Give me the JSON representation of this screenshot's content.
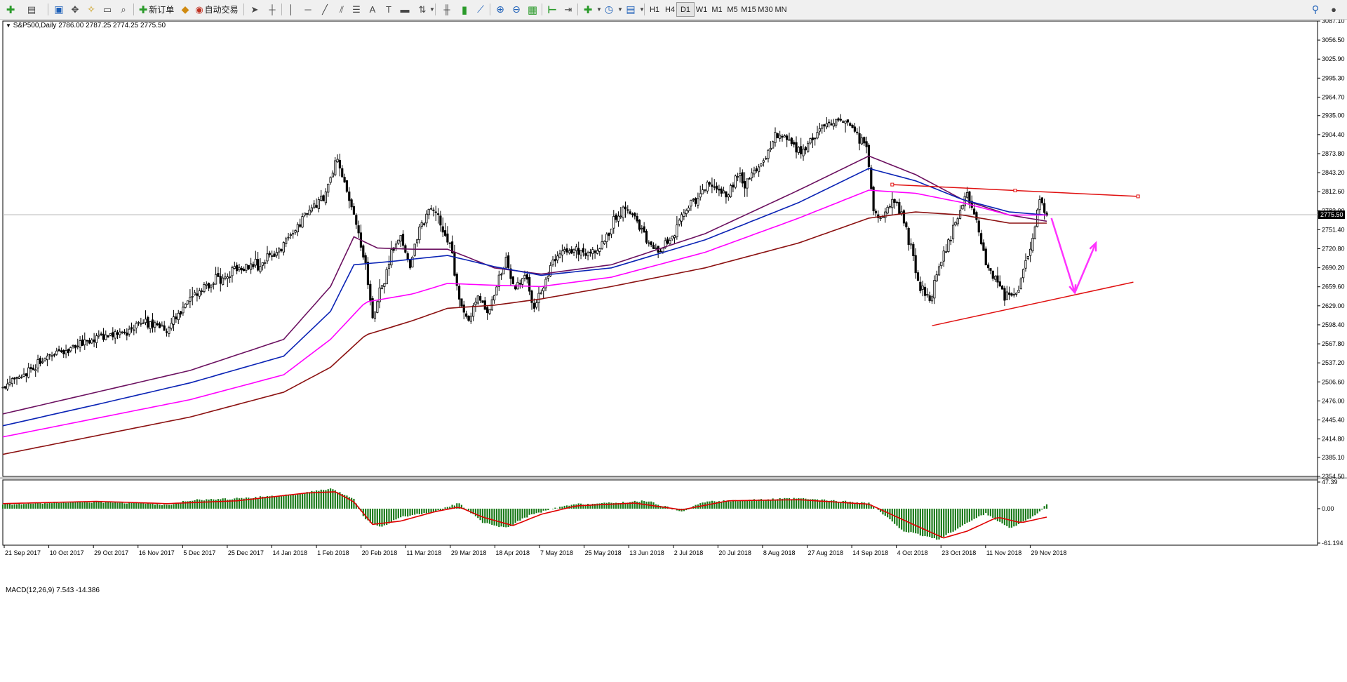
{
  "toolbar": {
    "new_order_label": "新订单",
    "auto_trading_label": "自动交易",
    "timeframes": [
      "H1",
      "H4",
      "D1",
      "W1",
      "M1",
      "M5",
      "M15",
      "M30",
      "MN"
    ],
    "active_timeframe": "D1"
  },
  "chart_header": {
    "symbol_label": "S&P500,Daily",
    "ohlc": "2786.00 2787.25 2774.25 2775.50"
  },
  "macd_header": {
    "label": "MACD(12,26,9)",
    "values": "7.543 -14.386"
  },
  "colors": {
    "candle": "#000000",
    "ma_fast": "#6b1060",
    "ma_mid": "#0a23b5",
    "ma_slow": "#ff00ff",
    "ma_long": "#8b1010",
    "trendline": "#e01010",
    "arrow": "#ff33ff",
    "macd_hist": "#1a7a1a",
    "macd_signal": "#e00000",
    "price_line": "#b8b8b8"
  },
  "chart_data": {
    "type": "candlestick",
    "symbol": "S&P500",
    "timeframe": "Daily",
    "current_price": 2775.5,
    "ylim": [
      2354.5,
      3087.1
    ],
    "y_ticks": [
      "3087.10",
      "3056.50",
      "3025.90",
      "2995.30",
      "2964.70",
      "2935.00",
      "2904.40",
      "2873.80",
      "2843.20",
      "2812.60",
      "2782.00",
      "2751.40",
      "2720.80",
      "2690.20",
      "2659.60",
      "2629.00",
      "2598.40",
      "2567.80",
      "2537.20",
      "2506.60",
      "2476.00",
      "2445.40",
      "2414.80",
      "2385.10",
      "2354.50"
    ],
    "x_ticks": [
      "21 Sep 2017",
      "10 Oct 2017",
      "29 Oct 2017",
      "16 Nov 2017",
      "5 Dec 2017",
      "25 Dec 2017",
      "14 Jan 2018",
      "1 Feb 2018",
      "20 Feb 2018",
      "11 Mar 2018",
      "29 Mar 2018",
      "18 Apr 2018",
      "7 May 2018",
      "25 May 2018",
      "13 Jun 2018",
      "2 Jul 2018",
      "20 Jul 2018",
      "8 Aug 2018",
      "27 Aug 2018",
      "14 Sep 2018",
      "4 Oct 2018",
      "23 Oct 2018",
      "11 Nov 2018",
      "29 Nov 2018"
    ],
    "price_path": [
      [
        0,
        2500
      ],
      [
        10,
        2520
      ],
      [
        20,
        2550
      ],
      [
        30,
        2562
      ],
      [
        40,
        2578
      ],
      [
        50,
        2585
      ],
      [
        60,
        2600
      ],
      [
        70,
        2592
      ],
      [
        80,
        2642
      ],
      [
        90,
        2668
      ],
      [
        100,
        2688
      ],
      [
        110,
        2695
      ],
      [
        120,
        2725
      ],
      [
        130,
        2780
      ],
      [
        137,
        2800
      ],
      [
        143,
        2870
      ],
      [
        146,
        2830
      ],
      [
        150,
        2780
      ],
      [
        155,
        2700
      ],
      [
        158,
        2612
      ],
      [
        162,
        2660
      ],
      [
        166,
        2710
      ],
      [
        170,
        2745
      ],
      [
        174,
        2690
      ],
      [
        178,
        2752
      ],
      [
        183,
        2785
      ],
      [
        187,
        2760
      ],
      [
        191,
        2730
      ],
      [
        195,
        2640
      ],
      [
        199,
        2605
      ],
      [
        203,
        2650
      ],
      [
        207,
        2620
      ],
      [
        211,
        2660
      ],
      [
        215,
        2700
      ],
      [
        219,
        2655
      ],
      [
        223,
        2680
      ],
      [
        227,
        2630
      ],
      [
        231,
        2660
      ],
      [
        235,
        2700
      ],
      [
        239,
        2720
      ],
      [
        245,
        2715
      ],
      [
        251,
        2712
      ],
      [
        256,
        2728
      ],
      [
        261,
        2765
      ],
      [
        265,
        2780
      ],
      [
        270,
        2770
      ],
      [
        274,
        2740
      ],
      [
        278,
        2720
      ],
      [
        284,
        2725
      ],
      [
        290,
        2770
      ],
      [
        294,
        2800
      ],
      [
        298,
        2808
      ],
      [
        302,
        2830
      ],
      [
        306,
        2815
      ],
      [
        310,
        2810
      ],
      [
        314,
        2840
      ],
      [
        318,
        2825
      ],
      [
        322,
        2850
      ],
      [
        326,
        2870
      ],
      [
        330,
        2900
      ],
      [
        334,
        2905
      ],
      [
        338,
        2885
      ],
      [
        342,
        2875
      ],
      [
        346,
        2900
      ],
      [
        350,
        2915
      ],
      [
        354,
        2925
      ],
      [
        358,
        2930
      ],
      [
        362,
        2925
      ],
      [
        366,
        2900
      ],
      [
        369,
        2880
      ],
      [
        372,
        2780
      ],
      [
        376,
        2765
      ],
      [
        380,
        2800
      ],
      [
        384,
        2780
      ],
      [
        388,
        2720
      ],
      [
        392,
        2660
      ],
      [
        396,
        2640
      ],
      [
        400,
        2690
      ],
      [
        404,
        2730
      ],
      [
        408,
        2770
      ],
      [
        412,
        2810
      ],
      [
        416,
        2760
      ],
      [
        420,
        2700
      ],
      [
        424,
        2670
      ],
      [
        428,
        2645
      ],
      [
        432,
        2640
      ],
      [
        436,
        2680
      ],
      [
        440,
        2740
      ],
      [
        443,
        2800
      ],
      [
        446,
        2775
      ]
    ],
    "ma_periods_pixels_note": "",
    "ema": [
      {
        "name": "MA-fast",
        "points": [
          [
            0,
            2455
          ],
          [
            40,
            2490
          ],
          [
            80,
            2525
          ],
          [
            120,
            2575
          ],
          [
            140,
            2660
          ],
          [
            150,
            2740
          ],
          [
            160,
            2722
          ],
          [
            175,
            2720
          ],
          [
            190,
            2720
          ],
          [
            210,
            2690
          ],
          [
            230,
            2680
          ],
          [
            260,
            2695
          ],
          [
            300,
            2745
          ],
          [
            340,
            2815
          ],
          [
            370,
            2870
          ],
          [
            390,
            2840
          ],
          [
            410,
            2800
          ],
          [
            430,
            2775
          ],
          [
            446,
            2765
          ]
        ]
      },
      {
        "name": "MA-mid",
        "points": [
          [
            0,
            2436
          ],
          [
            40,
            2470
          ],
          [
            80,
            2505
          ],
          [
            120,
            2548
          ],
          [
            140,
            2620
          ],
          [
            150,
            2695
          ],
          [
            165,
            2700
          ],
          [
            190,
            2710
          ],
          [
            210,
            2692
          ],
          [
            230,
            2678
          ],
          [
            260,
            2690
          ],
          [
            300,
            2735
          ],
          [
            340,
            2795
          ],
          [
            370,
            2850
          ],
          [
            390,
            2830
          ],
          [
            410,
            2800
          ],
          [
            430,
            2780
          ],
          [
            446,
            2775
          ]
        ]
      },
      {
        "name": "MA-slow",
        "points": [
          [
            0,
            2418
          ],
          [
            40,
            2448
          ],
          [
            80,
            2478
          ],
          [
            120,
            2518
          ],
          [
            140,
            2575
          ],
          [
            155,
            2635
          ],
          [
            175,
            2648
          ],
          [
            190,
            2665
          ],
          [
            210,
            2662
          ],
          [
            230,
            2660
          ],
          [
            260,
            2675
          ],
          [
            300,
            2715
          ],
          [
            340,
            2770
          ],
          [
            370,
            2815
          ],
          [
            390,
            2810
          ],
          [
            410,
            2795
          ],
          [
            430,
            2775
          ],
          [
            446,
            2775
          ]
        ]
      },
      {
        "name": "MA-long",
        "points": [
          [
            0,
            2390
          ],
          [
            40,
            2420
          ],
          [
            80,
            2450
          ],
          [
            120,
            2490
          ],
          [
            140,
            2530
          ],
          [
            155,
            2582
          ],
          [
            175,
            2605
          ],
          [
            190,
            2625
          ],
          [
            210,
            2630
          ],
          [
            230,
            2640
          ],
          [
            260,
            2660
          ],
          [
            300,
            2690
          ],
          [
            340,
            2730
          ],
          [
            370,
            2770
          ],
          [
            390,
            2780
          ],
          [
            410,
            2775
          ],
          [
            430,
            2762
          ],
          [
            446,
            2762
          ]
        ]
      }
    ],
    "trendlines": [
      {
        "name": "resistance",
        "from": [
          380,
          2824
        ],
        "to": [
          485,
          2805
        ],
        "handles": true
      },
      {
        "name": "support",
        "from": [
          397,
          2597
        ],
        "to": [
          483,
          2667
        ],
        "handles": false
      }
    ],
    "projection_arrows": [
      {
        "name": "down-arrow",
        "from": [
          448,
          2770
        ],
        "to": [
          458,
          2650
        ]
      },
      {
        "name": "up-arrow",
        "from": [
          458,
          2650
        ],
        "to": [
          467,
          2730
        ]
      }
    ],
    "macd": {
      "ylim": [
        -61.194,
        47.39
      ],
      "y_ticks": [
        "47.39",
        "0.00",
        "-61.194"
      ],
      "histogram_path": [
        [
          0,
          8
        ],
        [
          30,
          12
        ],
        [
          60,
          10
        ],
        [
          70,
          6
        ],
        [
          80,
          15
        ],
        [
          100,
          18
        ],
        [
          125,
          25
        ],
        [
          135,
          32
        ],
        [
          140,
          35
        ],
        [
          150,
          18
        ],
        [
          155,
          -20
        ],
        [
          162,
          -33
        ],
        [
          170,
          -15
        ],
        [
          185,
          -5
        ],
        [
          195,
          10
        ],
        [
          205,
          -25
        ],
        [
          215,
          -34
        ],
        [
          225,
          -12
        ],
        [
          235,
          0
        ],
        [
          245,
          8
        ],
        [
          260,
          10
        ],
        [
          275,
          14
        ],
        [
          290,
          -5
        ],
        [
          300,
          12
        ],
        [
          320,
          16
        ],
        [
          340,
          18
        ],
        [
          355,
          14
        ],
        [
          370,
          10
        ],
        [
          385,
          -40
        ],
        [
          400,
          -55
        ],
        [
          410,
          -30
        ],
        [
          420,
          -8
        ],
        [
          430,
          -35
        ],
        [
          440,
          -15
        ],
        [
          446,
          7
        ]
      ],
      "signal_path": [
        [
          0,
          9
        ],
        [
          40,
          13
        ],
        [
          70,
          9
        ],
        [
          100,
          14
        ],
        [
          130,
          28
        ],
        [
          142,
          30
        ],
        [
          150,
          12
        ],
        [
          158,
          -28
        ],
        [
          170,
          -22
        ],
        [
          185,
          -5
        ],
        [
          195,
          3
        ],
        [
          205,
          -15
        ],
        [
          218,
          -30
        ],
        [
          230,
          -10
        ],
        [
          245,
          5
        ],
        [
          270,
          10
        ],
        [
          290,
          -2
        ],
        [
          310,
          14
        ],
        [
          340,
          16
        ],
        [
          370,
          8
        ],
        [
          390,
          -30
        ],
        [
          402,
          -52
        ],
        [
          412,
          -40
        ],
        [
          425,
          -15
        ],
        [
          435,
          -25
        ],
        [
          446,
          -15
        ]
      ]
    }
  }
}
